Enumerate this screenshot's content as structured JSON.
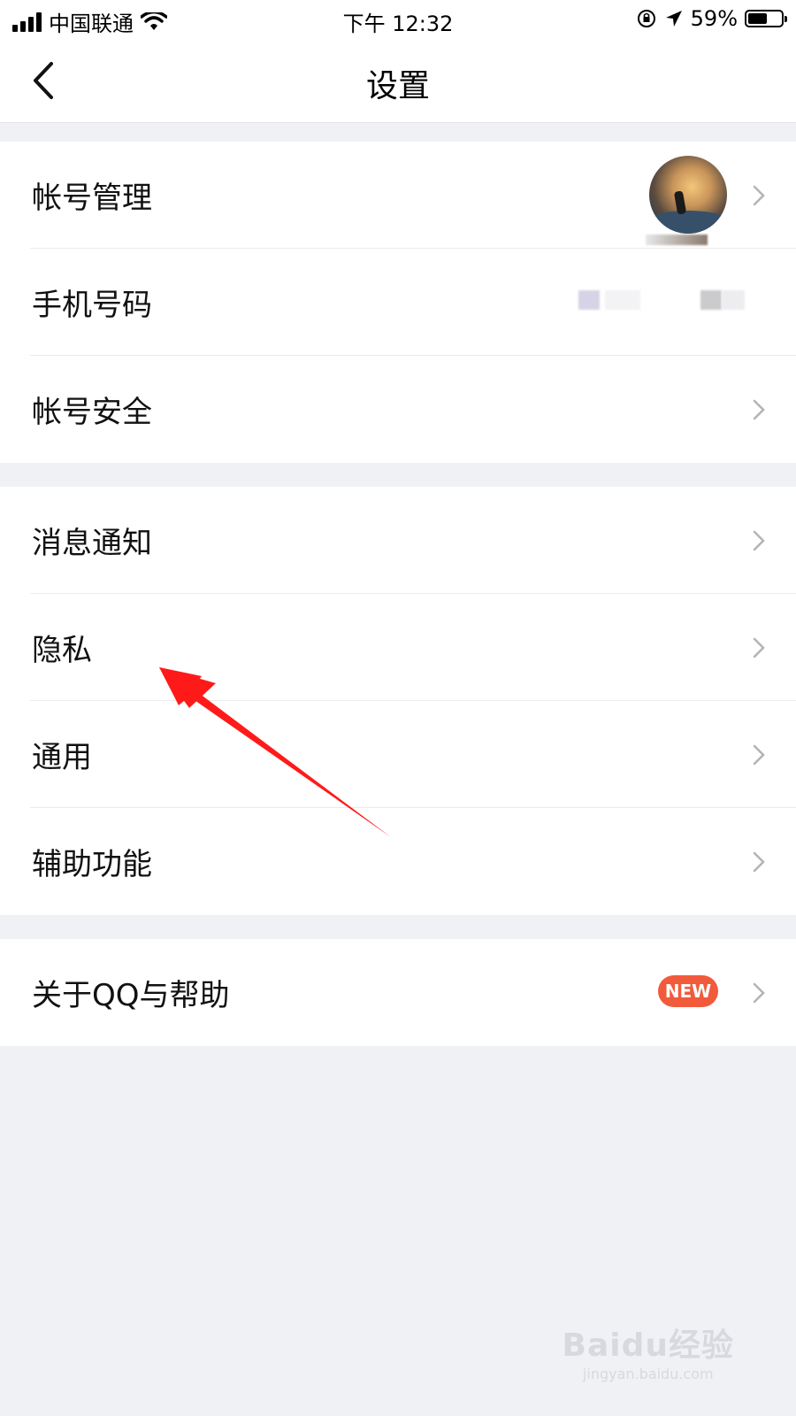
{
  "status_bar": {
    "carrier": "中国联通",
    "time": "下午 12:32",
    "battery": "59%",
    "battery_level": 0.59
  },
  "nav": {
    "title": "设置",
    "back_icon": "chevron-left-icon"
  },
  "groups": [
    {
      "items": [
        {
          "label": "帐号管理",
          "trailing": "avatar"
        },
        {
          "label": "手机号码",
          "trailing": "blurred-number"
        },
        {
          "label": "帐号安全",
          "trailing": "chevron"
        }
      ]
    },
    {
      "items": [
        {
          "label": "消息通知"
        },
        {
          "label": "隐私"
        },
        {
          "label": "通用"
        },
        {
          "label": "辅助功能"
        }
      ]
    },
    {
      "items": [
        {
          "label": "关于QQ与帮助",
          "badge": "NEW"
        }
      ]
    }
  ],
  "colors": {
    "background": "#f0f1f5",
    "badge": "#f25a3c",
    "annotation_arrow": "#ff1a1a"
  },
  "watermark": {
    "main": "Baidu经验",
    "sub": "jingyan.baidu.com"
  }
}
